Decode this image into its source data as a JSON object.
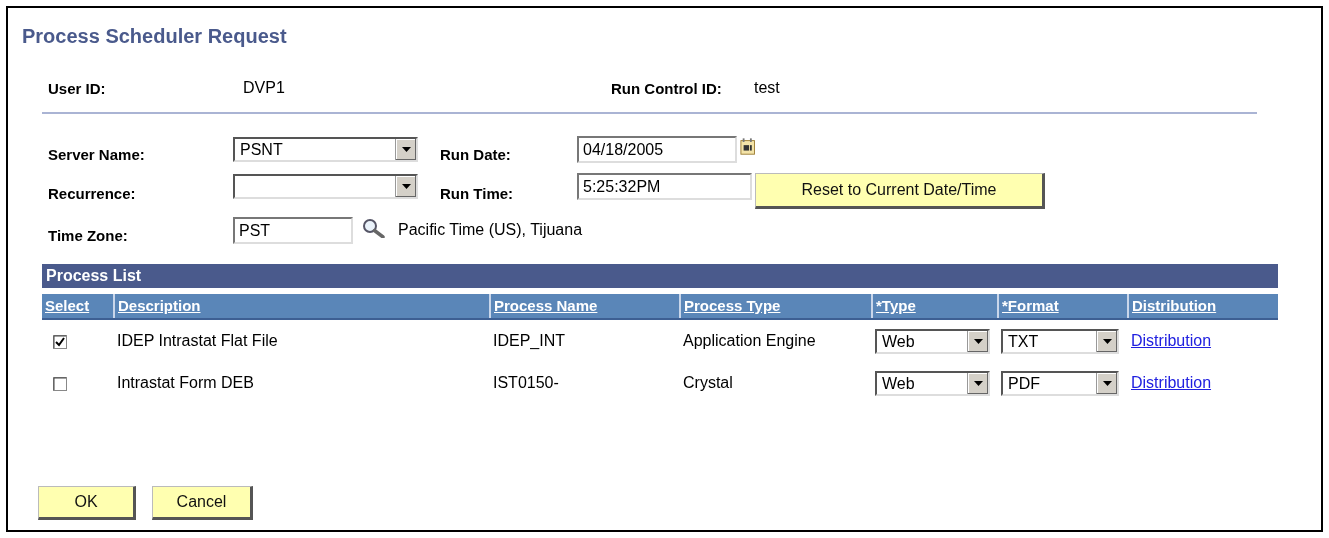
{
  "title": "Process Scheduler Request",
  "user_id": {
    "label": "User ID:",
    "value": "DVP1"
  },
  "run_control_id": {
    "label": "Run Control ID:",
    "value": "test"
  },
  "server_name": {
    "label": "Server Name:",
    "value": "PSNT"
  },
  "recurrence": {
    "label": "Recurrence:"
  },
  "time_zone": {
    "label": "Time Zone:",
    "value": "PST",
    "description": "Pacific Time (US), Tijuana"
  },
  "run_date": {
    "label": "Run Date:",
    "value": "04/18/2005"
  },
  "run_time": {
    "label": "Run Time:",
    "value": "5:25:32PM"
  },
  "reset_button": "Reset to Current Date/Time",
  "process_list": {
    "title": "Process List",
    "columns": [
      "Select",
      "Description",
      "Process Name",
      "Process Type",
      "*Type",
      "*Format",
      "Distribution"
    ],
    "rows": [
      {
        "selected": true,
        "description": "IDEP Intrastat Flat File",
        "process_name": "IDEP_INT",
        "process_type": "Application Engine",
        "type": "Web",
        "format": "TXT",
        "distribution": "Distribution"
      },
      {
        "selected": false,
        "description": "Intrastat Form DEB",
        "process_name": "IST0150-",
        "process_type": "Crystal",
        "type": "Web",
        "format": "PDF",
        "distribution": "Distribution"
      }
    ]
  },
  "buttons": [
    "OK",
    "Cancel"
  ]
}
